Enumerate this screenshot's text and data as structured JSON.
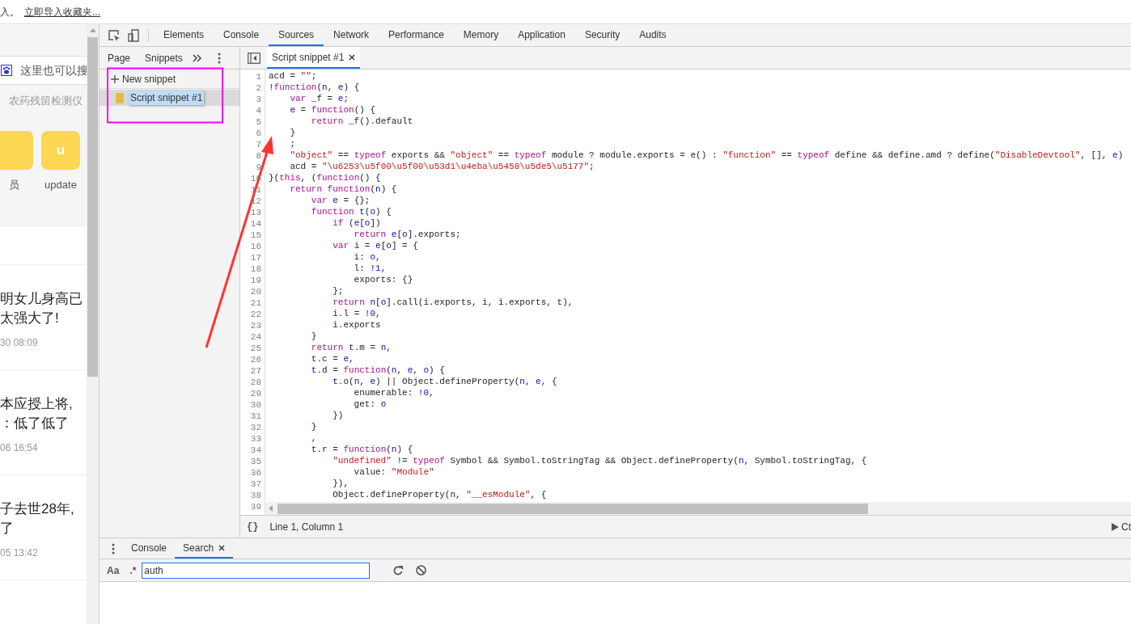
{
  "bookmark_bar": {
    "text": "入。",
    "link": "立即导入收藏夹..."
  },
  "web_page": {
    "search_placeholder": "这里也可以搜",
    "hint": "农药残留检测仪",
    "apps": [
      {
        "label": "员"
      },
      {
        "letter": "u",
        "label": "update"
      }
    ],
    "news": [
      {
        "lines": [
          "明女儿身高已",
          "太强大了!"
        ],
        "time": "30 08:09"
      },
      {
        "lines": [
          "本应授上将,",
          "：低了低了"
        ],
        "time": "06 16:54"
      },
      {
        "lines": [
          "子去世28年,",
          "了"
        ],
        "time": "05 13:42"
      }
    ]
  },
  "devtools": {
    "tabs": [
      {
        "label": "Elements",
        "selected": false
      },
      {
        "label": "Console",
        "selected": false
      },
      {
        "label": "Sources",
        "selected": true
      },
      {
        "label": "Network",
        "selected": false
      },
      {
        "label": "Performance",
        "selected": false
      },
      {
        "label": "Memory",
        "selected": false
      },
      {
        "label": "Application",
        "selected": false
      },
      {
        "label": "Security",
        "selected": false
      },
      {
        "label": "Audits",
        "selected": false
      }
    ],
    "navigator": {
      "tabs": [
        "Page",
        "Snippets"
      ],
      "new_snippet": "New snippet",
      "files": [
        {
          "name": "Script snippet #1",
          "selected": true
        }
      ]
    },
    "editor": {
      "tabs": [
        {
          "label": "Script snippet #1",
          "selected": true
        }
      ],
      "lines": [
        {
          "no": "1",
          "c": [
            {
              "kind": "plain",
              "text": "acd = "
            },
            {
              "kind": "string",
              "text": "\"\""
            },
            {
              "kind": "plain",
              "text": ";"
            }
          ]
        },
        {
          "no": "2",
          "c": [
            {
              "kind": "plain",
              "text": "!"
            },
            {
              "kind": "keyword",
              "text": "function"
            },
            {
              "kind": "plain",
              "text": "("
            },
            {
              "kind": "value",
              "text": "n"
            },
            {
              "kind": "plain",
              "text": ", "
            },
            {
              "kind": "value",
              "text": "e"
            },
            {
              "kind": "plain",
              "text": ") {"
            }
          ]
        },
        {
          "no": "3",
          "c": [
            {
              "kind": "keyword",
              "text": "    var"
            },
            {
              "kind": "plain",
              "text": " _f = "
            },
            {
              "kind": "value",
              "text": "e"
            },
            {
              "kind": "plain",
              "text": ";"
            }
          ]
        },
        {
          "no": "4",
          "c": [
            {
              "kind": "value",
              "text": "    e"
            },
            {
              "kind": "plain",
              "text": " = "
            },
            {
              "kind": "keyword",
              "text": "function"
            },
            {
              "kind": "plain",
              "text": "() {"
            }
          ]
        },
        {
          "no": "5",
          "c": [
            {
              "kind": "keyword",
              "text": "        return"
            },
            {
              "kind": "plain",
              "text": " _f().default"
            }
          ]
        },
        {
          "no": "6",
          "c": [
            {
              "kind": "plain",
              "text": "    }"
            }
          ]
        },
        {
          "no": "7",
          "c": [
            {
              "kind": "plain",
              "text": "    ;"
            }
          ]
        },
        {
          "no": "8",
          "c": [
            {
              "kind": "string",
              "text": "    \"object\""
            },
            {
              "kind": "plain",
              "text": " == "
            },
            {
              "kind": "keyword",
              "text": "typeof"
            },
            {
              "kind": "plain",
              "text": " exports && "
            },
            {
              "kind": "string",
              "text": "\"object\""
            },
            {
              "kind": "plain",
              "text": " == "
            },
            {
              "kind": "keyword",
              "text": "typeof"
            },
            {
              "kind": "plain",
              "text": " module ? module.exports = e() : "
            },
            {
              "kind": "string",
              "text": "\"function\""
            },
            {
              "kind": "plain",
              "text": " == "
            },
            {
              "kind": "keyword",
              "text": "typeof"
            },
            {
              "kind": "plain",
              "text": " define && define.amd ? define("
            },
            {
              "kind": "string",
              "text": "\"DisableDevtool\""
            },
            {
              "kind": "plain",
              "text": ", [], "
            },
            {
              "kind": "value",
              "text": "e"
            },
            {
              "kind": "plain",
              "text": ")"
            }
          ]
        },
        {
          "no": "9",
          "c": [
            {
              "kind": "plain",
              "text": "    acd = "
            },
            {
              "kind": "string",
              "text": "\"\\u6253\\u5f00\\u5f00\\u53d1\\u4eba\\u5458\\u5de5\\u5177\""
            },
            {
              "kind": "plain",
              "text": ";"
            }
          ]
        },
        {
          "no": "10",
          "c": [
            {
              "kind": "plain",
              "text": "}("
            },
            {
              "kind": "keyword",
              "text": "this"
            },
            {
              "kind": "plain",
              "text": ", ("
            },
            {
              "kind": "keyword",
              "text": "function"
            },
            {
              "kind": "plain",
              "text": "() {"
            }
          ]
        },
        {
          "no": "11",
          "c": [
            {
              "kind": "keyword",
              "text": "    return"
            },
            {
              "kind": "keyword",
              "text": " function"
            },
            {
              "kind": "plain",
              "text": "("
            },
            {
              "kind": "value",
              "text": "n"
            },
            {
              "kind": "plain",
              "text": ") {"
            }
          ]
        },
        {
          "no": "12",
          "c": [
            {
              "kind": "keyword",
              "text": "        var"
            },
            {
              "kind": "value",
              "text": " e"
            },
            {
              "kind": "plain",
              "text": " = {};"
            }
          ]
        },
        {
          "no": "13",
          "c": [
            {
              "kind": "keyword",
              "text": "        function"
            },
            {
              "kind": "value",
              "text": " t"
            },
            {
              "kind": "plain",
              "text": "("
            },
            {
              "kind": "value",
              "text": "o"
            },
            {
              "kind": "plain",
              "text": ") {"
            }
          ]
        },
        {
          "no": "14",
          "c": [
            {
              "kind": "keyword",
              "text": "            if"
            },
            {
              "kind": "plain",
              "text": " ("
            },
            {
              "kind": "value",
              "text": "e"
            },
            {
              "kind": "plain",
              "text": "["
            },
            {
              "kind": "value",
              "text": "o"
            },
            {
              "kind": "plain",
              "text": "])"
            }
          ]
        },
        {
          "no": "15",
          "c": [
            {
              "kind": "keyword",
              "text": "                return"
            },
            {
              "kind": "value",
              "text": " e"
            },
            {
              "kind": "plain",
              "text": "["
            },
            {
              "kind": "value",
              "text": "o"
            },
            {
              "kind": "plain",
              "text": "].exports;"
            }
          ]
        },
        {
          "no": "16",
          "c": [
            {
              "kind": "keyword",
              "text": "            var"
            },
            {
              "kind": "value",
              "text": " i"
            },
            {
              "kind": "plain",
              "text": " = "
            },
            {
              "kind": "value",
              "text": "e"
            },
            {
              "kind": "plain",
              "text": "["
            },
            {
              "kind": "value",
              "text": "o"
            },
            {
              "kind": "plain",
              "text": "] = {"
            }
          ]
        },
        {
          "no": "17",
          "c": [
            {
              "kind": "plain",
              "text": "                i: "
            },
            {
              "kind": "value",
              "text": "o"
            },
            {
              "kind": "plain",
              "text": ","
            }
          ]
        },
        {
          "no": "18",
          "c": [
            {
              "kind": "plain",
              "text": "                l: "
            },
            {
              "kind": "value",
              "text": "!1"
            },
            {
              "kind": "plain",
              "text": ","
            }
          ]
        },
        {
          "no": "19",
          "c": [
            {
              "kind": "plain",
              "text": "                exports: {}"
            }
          ]
        },
        {
          "no": "20",
          "c": [
            {
              "kind": "plain",
              "text": "            };"
            }
          ]
        },
        {
          "no": "21",
          "c": [
            {
              "kind": "keyword",
              "text": "            return"
            },
            {
              "kind": "value",
              "text": " n"
            },
            {
              "kind": "plain",
              "text": "["
            },
            {
              "kind": "value",
              "text": "o"
            },
            {
              "kind": "plain",
              "text": "].call("
            },
            {
              "kind": "value",
              "text": "i"
            },
            {
              "kind": "plain",
              "text": ".exports, "
            },
            {
              "kind": "value",
              "text": "i"
            },
            {
              "kind": "plain",
              "text": ", "
            },
            {
              "kind": "value",
              "text": "i"
            },
            {
              "kind": "plain",
              "text": ".exports, "
            },
            {
              "kind": "value",
              "text": "t"
            },
            {
              "kind": "plain",
              "text": "),"
            }
          ]
        },
        {
          "no": "22",
          "c": [
            {
              "kind": "value",
              "text": "            i"
            },
            {
              "kind": "plain",
              "text": ".l = "
            },
            {
              "kind": "value",
              "text": "!0"
            },
            {
              "kind": "plain",
              "text": ","
            }
          ]
        },
        {
          "no": "23",
          "c": [
            {
              "kind": "value",
              "text": "            i"
            },
            {
              "kind": "plain",
              "text": ".exports"
            }
          ]
        },
        {
          "no": "24",
          "c": [
            {
              "kind": "plain",
              "text": "        }"
            }
          ]
        },
        {
          "no": "25",
          "c": [
            {
              "kind": "keyword",
              "text": "        return"
            },
            {
              "kind": "value",
              "text": " t"
            },
            {
              "kind": "plain",
              "text": ".m = "
            },
            {
              "kind": "value",
              "text": "n"
            },
            {
              "kind": "plain",
              "text": ","
            }
          ]
        },
        {
          "no": "26",
          "c": [
            {
              "kind": "value",
              "text": "        t"
            },
            {
              "kind": "plain",
              "text": ".c = "
            },
            {
              "kind": "value",
              "text": "e"
            },
            {
              "kind": "plain",
              "text": ","
            }
          ]
        },
        {
          "no": "27",
          "c": [
            {
              "kind": "value",
              "text": "        t"
            },
            {
              "kind": "plain",
              "text": ".d = "
            },
            {
              "kind": "keyword",
              "text": "function"
            },
            {
              "kind": "plain",
              "text": "("
            },
            {
              "kind": "value",
              "text": "n"
            },
            {
              "kind": "plain",
              "text": ", "
            },
            {
              "kind": "value",
              "text": "e"
            },
            {
              "kind": "plain",
              "text": ", "
            },
            {
              "kind": "value",
              "text": "o"
            },
            {
              "kind": "plain",
              "text": ") {"
            }
          ]
        },
        {
          "no": "28",
          "c": [
            {
              "kind": "value",
              "text": "            t"
            },
            {
              "kind": "plain",
              "text": ".o("
            },
            {
              "kind": "value",
              "text": "n"
            },
            {
              "kind": "plain",
              "text": ", "
            },
            {
              "kind": "value",
              "text": "e"
            },
            {
              "kind": "plain",
              "text": ") || Object.defineProperty("
            },
            {
              "kind": "value",
              "text": "n"
            },
            {
              "kind": "plain",
              "text": ", "
            },
            {
              "kind": "value",
              "text": "e"
            },
            {
              "kind": "plain",
              "text": ", {"
            }
          ]
        },
        {
          "no": "29",
          "c": [
            {
              "kind": "plain",
              "text": "                enumerable: "
            },
            {
              "kind": "value",
              "text": "!0"
            },
            {
              "kind": "plain",
              "text": ","
            }
          ]
        },
        {
          "no": "30",
          "c": [
            {
              "kind": "plain",
              "text": "                get: "
            },
            {
              "kind": "value",
              "text": "o"
            }
          ]
        },
        {
          "no": "31",
          "c": [
            {
              "kind": "plain",
              "text": "            })"
            }
          ]
        },
        {
          "no": "32",
          "c": [
            {
              "kind": "plain",
              "text": "        }"
            }
          ]
        },
        {
          "no": "33",
          "c": [
            {
              "kind": "plain",
              "text": "        ,"
            }
          ]
        },
        {
          "no": "34",
          "c": [
            {
              "kind": "value",
              "text": "        t"
            },
            {
              "kind": "plain",
              "text": ".r = "
            },
            {
              "kind": "keyword",
              "text": "function"
            },
            {
              "kind": "plain",
              "text": "("
            },
            {
              "kind": "value",
              "text": "n"
            },
            {
              "kind": "plain",
              "text": ") {"
            }
          ]
        },
        {
          "no": "35",
          "c": [
            {
              "kind": "string",
              "text": "            \"undefined\""
            },
            {
              "kind": "plain",
              "text": " != "
            },
            {
              "kind": "keyword",
              "text": "typeof"
            },
            {
              "kind": "plain",
              "text": " Symbol && Symbol.toStringTag && Object.defineProperty("
            },
            {
              "kind": "value",
              "text": "n"
            },
            {
              "kind": "plain",
              "text": ", Symbol.toStringTag, {"
            }
          ]
        },
        {
          "no": "36",
          "c": [
            {
              "kind": "plain",
              "text": "                value: "
            },
            {
              "kind": "string",
              "text": "\"Module\""
            }
          ]
        },
        {
          "no": "37",
          "c": [
            {
              "kind": "plain",
              "text": "            }),"
            }
          ]
        },
        {
          "no": "38",
          "c": [
            {
              "kind": "plain",
              "text": "            Object.defineProperty("
            },
            {
              "kind": "value",
              "text": "n"
            },
            {
              "kind": "plain",
              "text": ", "
            },
            {
              "kind": "string",
              "text": "\"__esModule\""
            },
            {
              "kind": "plain",
              "text": ", {"
            }
          ]
        },
        {
          "no": "39"
        }
      ],
      "format_button": "{}",
      "position": "Line 1, Column 1",
      "run_hint": "Ct"
    },
    "drawer": {
      "tabs": [
        {
          "label": "Console",
          "selected": false,
          "closable": false
        },
        {
          "label": "Search",
          "selected": true,
          "closable": true
        }
      ],
      "case_toggle": "Aa",
      "regex_toggle": ".*",
      "query": "auth"
    }
  }
}
